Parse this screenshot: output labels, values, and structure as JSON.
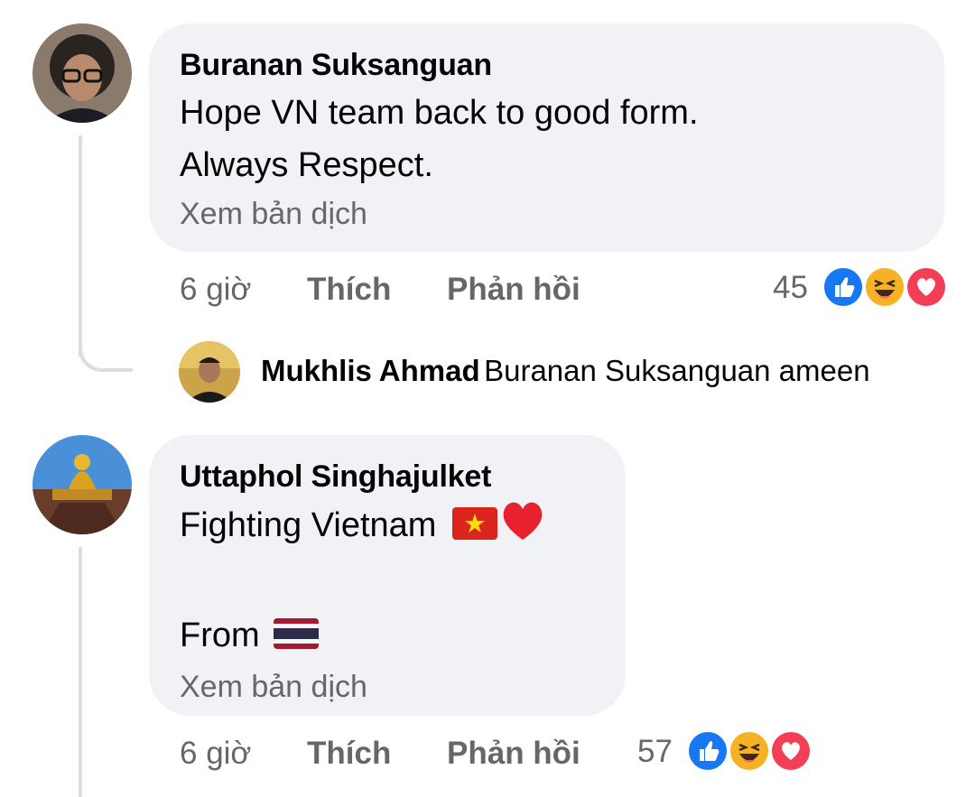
{
  "comments": [
    {
      "author": "Buranan Suksanguan",
      "text_lines": [
        "Hope VN team back to good form.",
        "Always Respect."
      ],
      "translate": "Xem bản dịch",
      "time": "6 giờ",
      "like": "Thích",
      "reply": "Phản hồi",
      "reaction_count": "45",
      "reactions": [
        "like-icon",
        "haha-icon",
        "love-icon"
      ]
    },
    {
      "author": "Uttaphol Singhajulket",
      "text_line1": "Fighting Vietnam",
      "text_line2": "From",
      "flags": [
        "vietnam-flag-icon",
        "heart-icon",
        "thailand-flag-icon"
      ],
      "translate": "Xem bản dịch",
      "time": "6 giờ",
      "like": "Thích",
      "reply": "Phản hồi",
      "reaction_count": "57",
      "reactions": [
        "like-icon",
        "haha-icon",
        "love-icon"
      ]
    }
  ],
  "reply": {
    "author": "Mukhlis Ahmad",
    "text": "Buranan Suksanguan ameen"
  },
  "colors": {
    "bubble": "#f0f2f5",
    "meta": "#65676b",
    "like_blue": "#1877f2",
    "love_red": "#f33e58",
    "haha_yellow": "#f7b125"
  }
}
